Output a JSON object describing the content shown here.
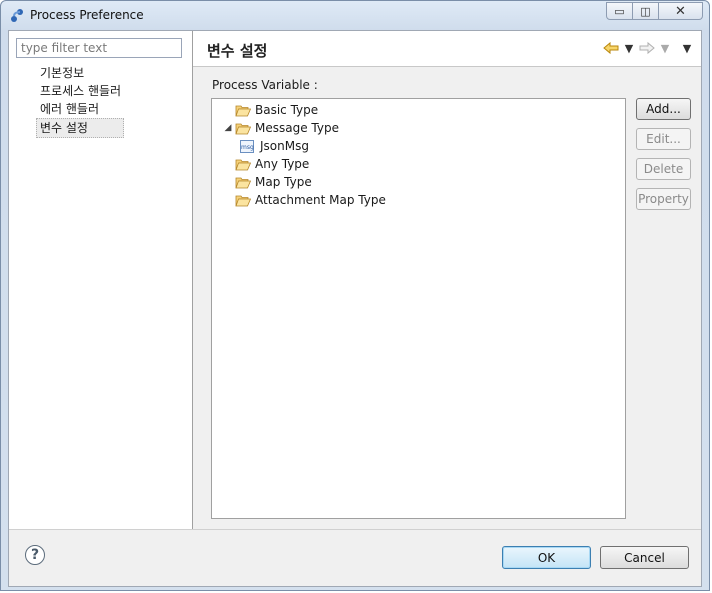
{
  "window": {
    "title": "Process Preference"
  },
  "sidebar": {
    "filter_placeholder": "type filter text",
    "items": [
      {
        "label": "기본정보"
      },
      {
        "label": "프로세스 핸들러"
      },
      {
        "label": "에러 핸들러"
      },
      {
        "label": "변수 설정",
        "selected": true
      }
    ]
  },
  "page": {
    "title": "변수 설정",
    "variable_label": "Process Variable :"
  },
  "tree": {
    "items": [
      {
        "label": "Basic Type",
        "icon": "folder-icon"
      },
      {
        "label": "Message Type",
        "icon": "folder-icon",
        "expanded": true
      },
      {
        "label": "JsonMsg",
        "icon": "message-icon",
        "icon_text": "msg"
      },
      {
        "label": "Any Type",
        "icon": "folder-icon"
      },
      {
        "label": "Map Type",
        "icon": "folder-icon"
      },
      {
        "label": "Attachment Map Type",
        "icon": "folder-icon"
      }
    ]
  },
  "buttons": {
    "add": "Add...",
    "edit": "Edit...",
    "delete": "Delete",
    "property": "Property"
  },
  "footer": {
    "ok": "OK",
    "cancel": "Cancel",
    "help": "?"
  },
  "colors": {
    "accent": "#3c7fb1",
    "folder": "#e8b84a",
    "disabled_text": "#8a8a8a"
  }
}
